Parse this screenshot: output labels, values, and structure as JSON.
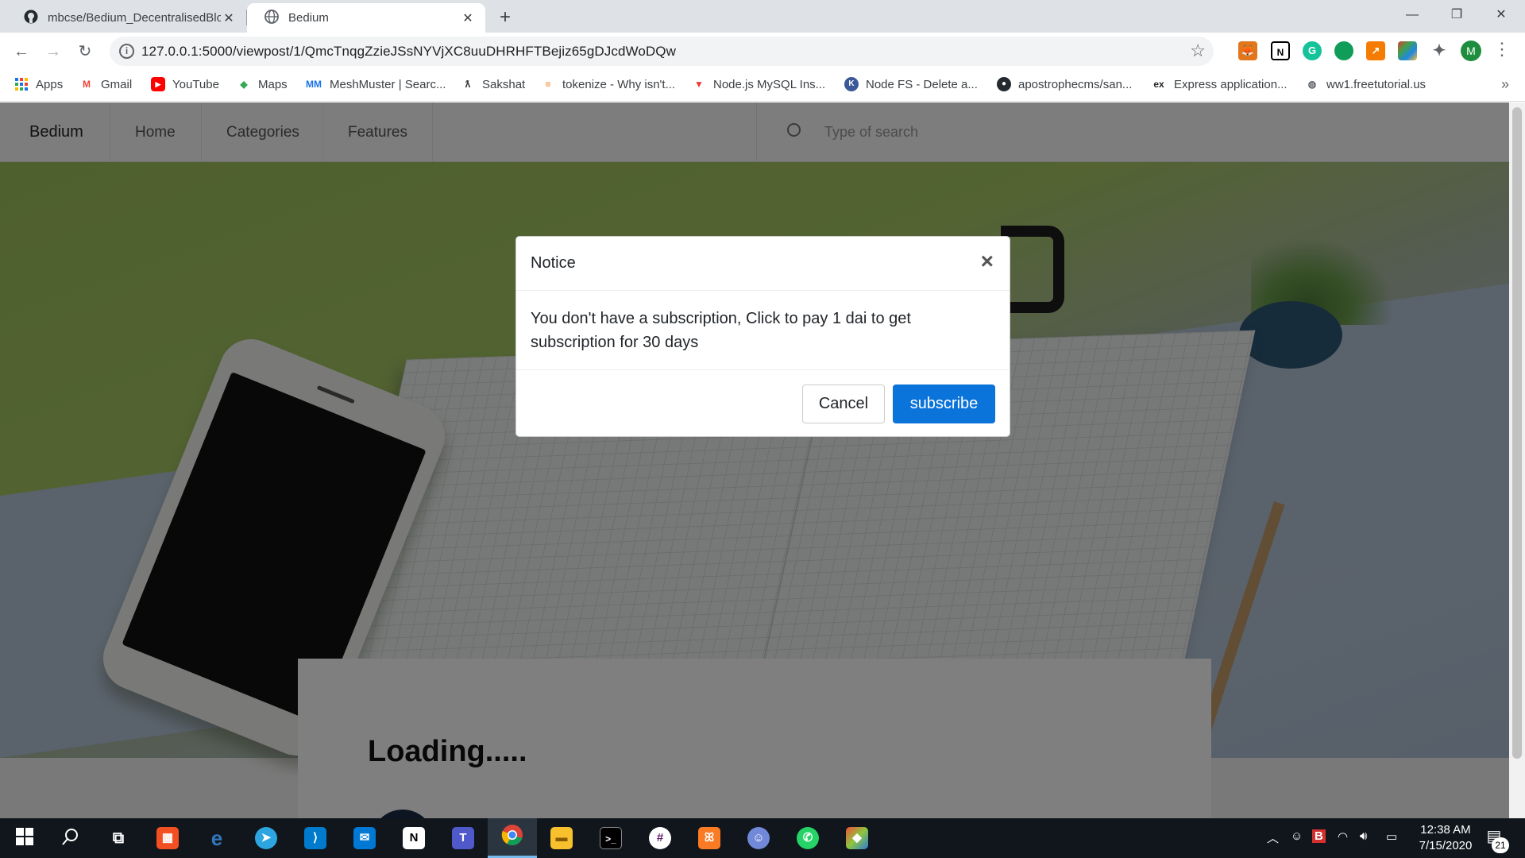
{
  "browser": {
    "tabs": [
      {
        "title": "mbcse/Bedium_DecentralisedBlo",
        "close": "✕"
      },
      {
        "title": "Bedium",
        "close": "✕"
      }
    ],
    "new_tab": "+",
    "window_controls": [
      "—",
      "❐",
      "✕"
    ],
    "url": "127.0.0.1:5000/viewpost/1/QmcTnqgZzieJSsNYVjXC8uuDHRHFTBejiz65gDJcdWoDQw",
    "profile_initial": "M",
    "bookmarks": [
      {
        "label": "Apps",
        "icon": "apps-grid-icon"
      },
      {
        "label": "Gmail",
        "icon": "gmail-icon"
      },
      {
        "label": "YouTube",
        "icon": "youtube-icon"
      },
      {
        "label": "Maps",
        "icon": "maps-icon"
      },
      {
        "label": "MeshMuster | Searc...",
        "icon": "meshmuster-icon"
      },
      {
        "label": "Sakshat",
        "icon": "sakshat-icon"
      },
      {
        "label": "tokenize - Why isn't...",
        "icon": "stackoverflow-icon"
      },
      {
        "label": "Node.js MySQL Ins...",
        "icon": "vivaldi-icon"
      },
      {
        "label": "Node FS - Delete a...",
        "icon": "node-fs-icon"
      },
      {
        "label": "apostrophecms/san...",
        "icon": "github-icon"
      },
      {
        "label": "Express application...",
        "icon": "express-icon"
      },
      {
        "label": "ww1.freetutorial.us",
        "icon": "globe-icon"
      }
    ],
    "bookmarks_more": "»"
  },
  "site": {
    "brand": "Bedium",
    "nav": [
      "Home",
      "Categories",
      "Features"
    ],
    "search_placeholder": "Type of search",
    "loading_text": "Loading....."
  },
  "modal": {
    "title": "Notice",
    "close": "×",
    "message": "You don't have a subscription, Click to pay 1 dai to get subscription for 30 days",
    "cancel_label": "Cancel",
    "subscribe_label": "subscribe"
  },
  "taskbar": {
    "time": "12:38 AM",
    "date": "7/15/2020",
    "notification_count": "21",
    "active_app": "chrome"
  },
  "colors": {
    "primary_button": "#0a74da",
    "overlay": "rgba(0,0,0,0.5)",
    "taskbar": "#10161c"
  }
}
